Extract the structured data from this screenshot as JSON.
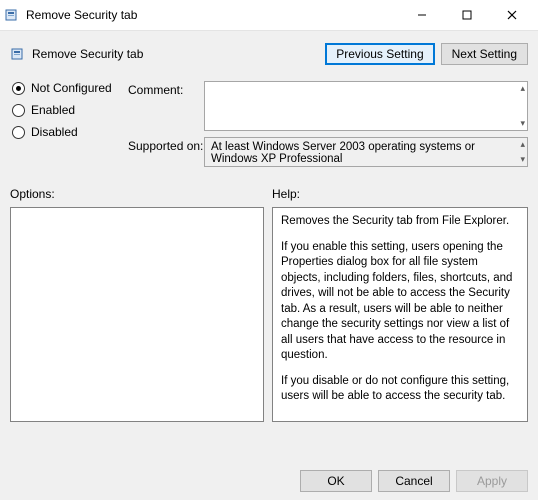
{
  "window": {
    "title": "Remove Security tab"
  },
  "header": {
    "title": "Remove Security tab",
    "prev_btn": "Previous Setting",
    "next_btn": "Next Setting"
  },
  "state": {
    "not_configured": "Not Configured",
    "enabled": "Enabled",
    "disabled": "Disabled",
    "selected": "not_configured"
  },
  "form": {
    "comment_label": "Comment:",
    "comment_value": "",
    "supported_label": "Supported on:",
    "supported_value": "At least Windows Server 2003 operating systems or Windows XP Professional"
  },
  "sections": {
    "options_label": "Options:",
    "help_label": "Help:",
    "help_text": {
      "p1": "Removes the Security tab from File Explorer.",
      "p2": "If you enable this setting, users opening the Properties dialog box for all file system objects, including folders, files, shortcuts, and drives, will not be able to access the Security tab. As a result, users will be able to neither change the security settings nor view a list of all users that have access to the resource in question.",
      "p3": "If you disable or do not configure this setting, users will be able to access the security tab."
    }
  },
  "footer": {
    "ok": "OK",
    "cancel": "Cancel",
    "apply": "Apply"
  }
}
